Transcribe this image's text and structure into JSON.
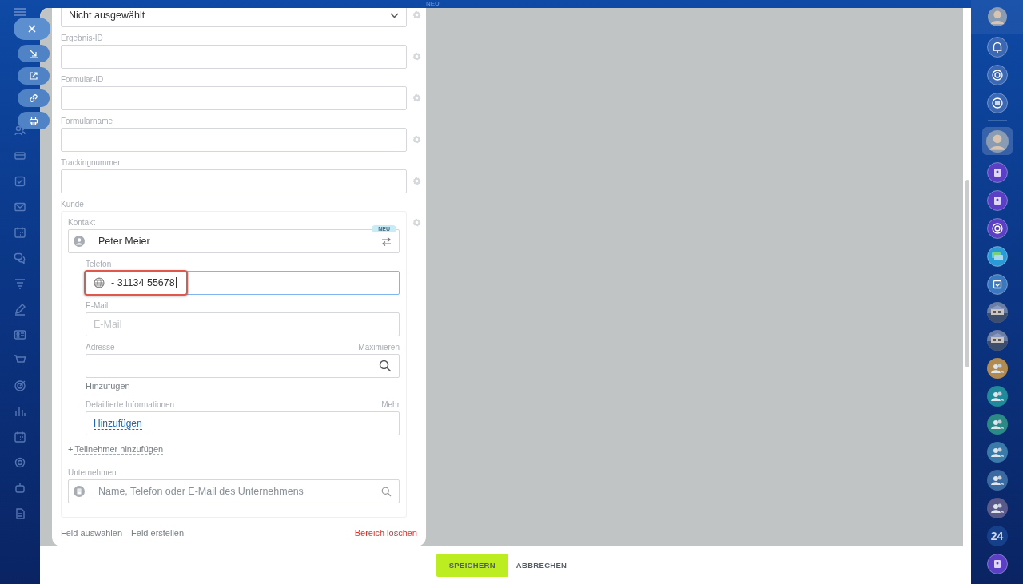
{
  "background_badge": "NEU",
  "top_select": {
    "value": "Nicht ausgewählt"
  },
  "fields": [
    {
      "label": "Ergebnis-ID"
    },
    {
      "label": "Formular-ID"
    },
    {
      "label": "Formularname"
    },
    {
      "label": "Trackingnummer"
    }
  ],
  "customer": {
    "label": "Kunde",
    "contact_label": "Kontakt",
    "contact": {
      "value": "Peter Meier",
      "badge": "NEU"
    },
    "phone": {
      "label": "Telefon",
      "value": "- 31134 55678",
      "highlighted": true
    },
    "email": {
      "label": "E-Mail",
      "placeholder": "E-Mail"
    },
    "address": {
      "label": "Adresse",
      "action": "Maximieren",
      "add_link": "Hinzufügen"
    },
    "details": {
      "label": "Detaillierte Informationen",
      "action": "Mehr",
      "link": "Hinzufügen"
    },
    "add_participant": {
      "icon": "+",
      "label": "Teilnehmer hinzufügen"
    },
    "company": {
      "label": "Unternehmen",
      "placeholder": "Name, Telefon oder E-Mail des Unternehmens"
    }
  },
  "section_links": [
    {
      "label": "Feld auswählen",
      "kind": "normal"
    },
    {
      "label": "Feld erstellen",
      "kind": "normal"
    },
    {
      "label": "Bereich löschen",
      "kind": "danger"
    }
  ],
  "buttons": [
    {
      "label": "SPEICHERN",
      "kind": "primary"
    },
    {
      "label": "ABBRECHEN",
      "kind": "link"
    }
  ],
  "top_icons": [
    {
      "kind": "avatar"
    },
    {
      "kind": "bell"
    },
    {
      "kind": "target"
    },
    {
      "kind": "chat"
    }
  ],
  "right_bar": [
    {
      "kind": "avatar",
      "selected": true
    },
    {
      "kind": "contact",
      "color": "#5b3fc4",
      "selected": false
    },
    {
      "kind": "contact",
      "color": "#5b3fc4",
      "selected": false
    },
    {
      "kind": "target",
      "color": "#5b3fc4",
      "selected": false
    },
    {
      "kind": "messages",
      "color": "#2b9bd8",
      "selected": false
    },
    {
      "kind": "task",
      "color": "#3a78c0",
      "selected": false
    },
    {
      "kind": "picture",
      "selected": false
    },
    {
      "kind": "picture",
      "selected": false
    },
    {
      "kind": "group",
      "color": "#b08a50",
      "selected": false
    },
    {
      "kind": "group",
      "color": "#1f8a9a",
      "selected": false
    },
    {
      "kind": "group",
      "color": "#2a8a86",
      "selected": false
    },
    {
      "kind": "group",
      "color": "#3a7aa8",
      "selected": false
    },
    {
      "kind": "group",
      "color": "#3a6aa0",
      "selected": false
    },
    {
      "kind": "group",
      "color": "#5a5a8a",
      "selected": false
    },
    {
      "kind": "text",
      "text": "24",
      "color": "#16408a",
      "selected": false
    },
    {
      "kind": "contact",
      "color": "#5b3fc4",
      "selected": false
    }
  ]
}
